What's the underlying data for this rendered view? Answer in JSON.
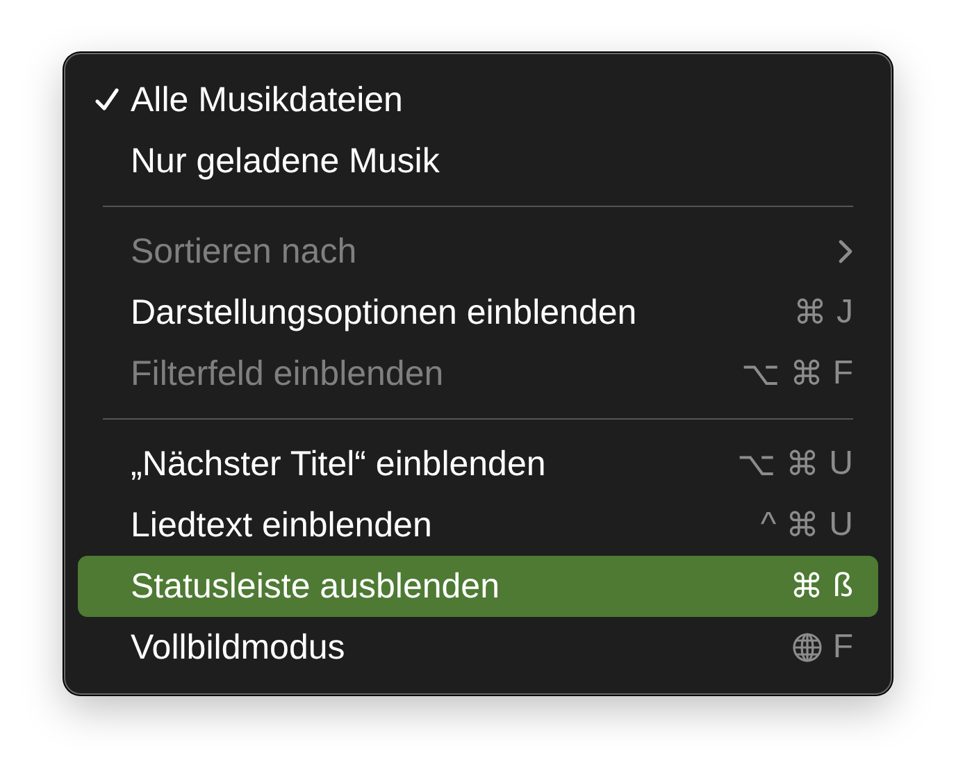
{
  "menu": {
    "sections": [
      {
        "items": [
          {
            "label": "Alle Musikdateien",
            "checked": true,
            "disabled": false,
            "selected": false
          },
          {
            "label": "Nur geladene Musik",
            "checked": false,
            "disabled": false,
            "selected": false
          }
        ]
      },
      {
        "items": [
          {
            "label": "Sortieren nach",
            "checked": false,
            "disabled": true,
            "selected": false,
            "submenu": true
          },
          {
            "label": "Darstellungsoptionen einblenden",
            "checked": false,
            "disabled": false,
            "selected": false,
            "shortcut": [
              "⌘",
              "J"
            ]
          },
          {
            "label": "Filterfeld einblenden",
            "checked": false,
            "disabled": true,
            "selected": false,
            "shortcut": [
              "⌥",
              "⌘",
              "F"
            ]
          }
        ]
      },
      {
        "items": [
          {
            "label": "„Nächster Titel“ einblenden",
            "checked": false,
            "disabled": false,
            "selected": false,
            "shortcut": [
              "⌥",
              "⌘",
              "U"
            ]
          },
          {
            "label": "Liedtext einblenden",
            "checked": false,
            "disabled": false,
            "selected": false,
            "shortcut": [
              "^",
              "⌘",
              "U"
            ]
          },
          {
            "label": "Statusleiste ausblenden",
            "checked": false,
            "disabled": false,
            "selected": true,
            "shortcut": [
              "⌘",
              "ß"
            ]
          },
          {
            "label": "Vollbildmodus",
            "checked": false,
            "disabled": false,
            "selected": false,
            "globe_key": true,
            "shortcut": [
              "F"
            ]
          }
        ]
      }
    ]
  }
}
